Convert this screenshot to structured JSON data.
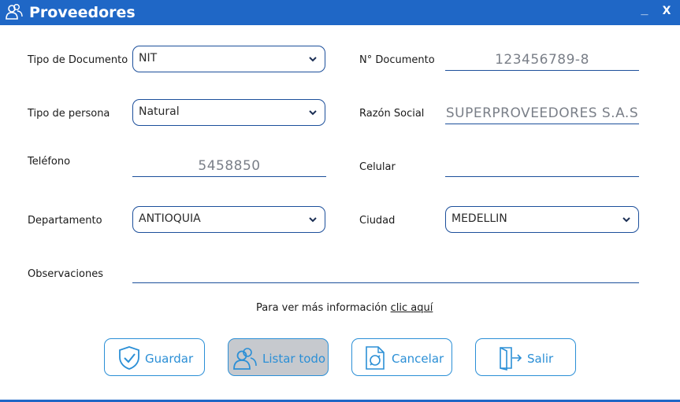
{
  "window": {
    "title": "Proveedores",
    "minimize": "_",
    "close": "X",
    "app_icon": "users-icon"
  },
  "form": {
    "tipo_documento": {
      "label": "Tipo de Documento",
      "value": "NIT"
    },
    "numero_documento": {
      "label": "N° Documento",
      "value": "123456789-8"
    },
    "tipo_persona": {
      "label": "Tipo de persona",
      "value": "Natural"
    },
    "razon_social": {
      "label": "Razón Social",
      "value": "SUPERPROVEEDORES S.A.S"
    },
    "telefono": {
      "label": "Teléfono",
      "value": "5458850"
    },
    "celular": {
      "label": "Celular",
      "value": ""
    },
    "departamento": {
      "label": "Departamento",
      "value": "ANTIOQUIA"
    },
    "ciudad": {
      "label": "Ciudad",
      "value": "MEDELLIN"
    },
    "observaciones": {
      "label": "Observaciones",
      "value": ""
    }
  },
  "info": {
    "text": "Para ver más información ",
    "link": "clic aquí"
  },
  "actions": {
    "guardar": {
      "label": "Guardar",
      "icon": "shield-check-icon"
    },
    "listar": {
      "label": "Listar todo",
      "icon": "users-icon",
      "active": true
    },
    "cancelar": {
      "label": "Cancelar",
      "icon": "document-refresh-icon"
    },
    "salir": {
      "label": "Salir",
      "icon": "door-exit-icon"
    }
  },
  "colors": {
    "titlebar": "#1f67c6",
    "accent": "#2b8fd6",
    "border": "#1c4f9b",
    "active_button": "#c6c9ce"
  }
}
